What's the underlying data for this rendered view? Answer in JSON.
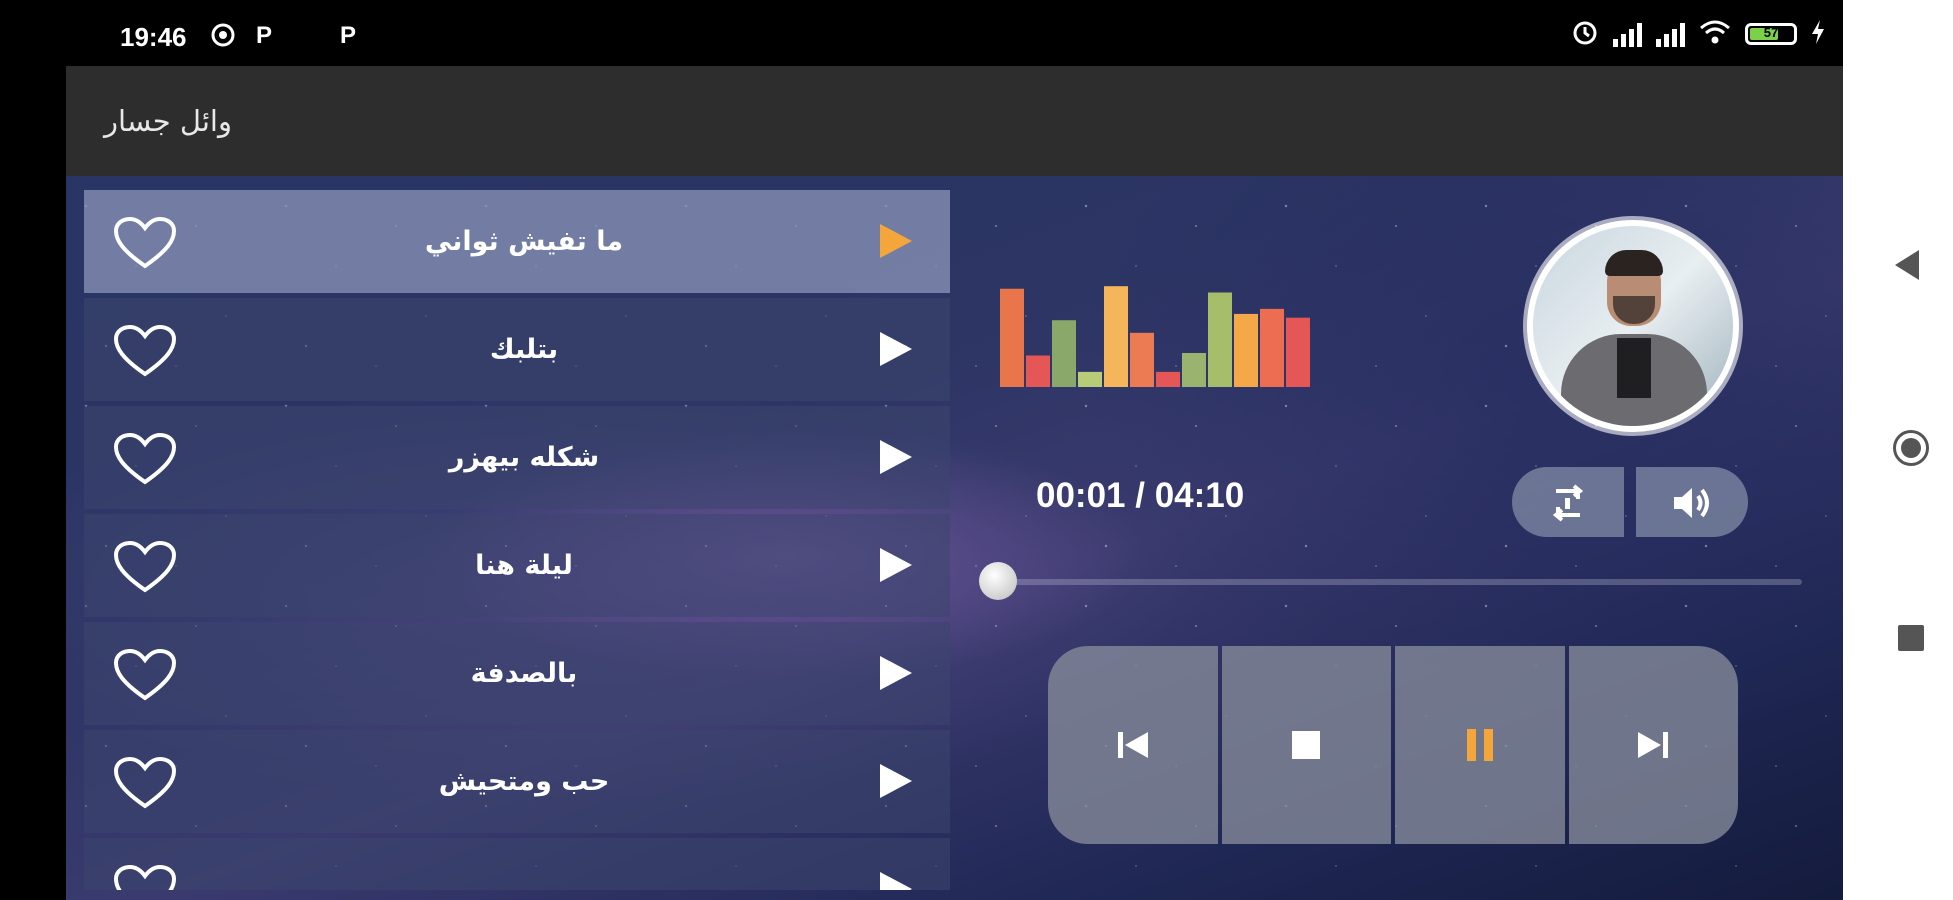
{
  "status_bar": {
    "time": "19:46",
    "notification_icons": [
      "sync-icon",
      "p-icon",
      "p-icon"
    ],
    "p_letter": "P",
    "battery_level": "57",
    "right_icons": [
      "alarm-icon",
      "signal-icon",
      "signal-icon",
      "wifi-icon",
      "battery-icon",
      "charging-icon"
    ]
  },
  "app_bar": {
    "title": "وائل جسار"
  },
  "playlist": {
    "tracks": [
      {
        "title": "ما تفيش ثواني",
        "active": true
      },
      {
        "title": "بتلبك",
        "active": false
      },
      {
        "title": "شكله بيهزر",
        "active": false
      },
      {
        "title": "ليلة هنا",
        "active": false
      },
      {
        "title": "بالصدفة",
        "active": false
      },
      {
        "title": "حب ومتحيش",
        "active": false
      },
      {
        "title": "",
        "active": false
      }
    ],
    "active_color": "#f5a63a"
  },
  "player": {
    "time_display": "00:01 / 04:10",
    "progress": 0.004,
    "equalizer_levels": [
      {
        "level": 0.78,
        "color": "#e8764a"
      },
      {
        "level": 0.25,
        "color": "#e55757"
      },
      {
        "level": 0.53,
        "color": "#8aa86a"
      },
      {
        "level": 0.12,
        "color": "#b8cc78"
      },
      {
        "level": 0.8,
        "color": "#f5b55a"
      },
      {
        "level": 0.43,
        "color": "#ec7a52"
      },
      {
        "level": 0.12,
        "color": "#e55757"
      },
      {
        "level": 0.27,
        "color": "#9ab46f"
      },
      {
        "level": 0.75,
        "color": "#a6bd6a"
      },
      {
        "level": 0.58,
        "color": "#f5a848"
      },
      {
        "level": 0.62,
        "color": "#ec6d52"
      },
      {
        "level": 0.55,
        "color": "#e55757"
      }
    ],
    "controls": [
      "skip-previous-icon",
      "stop-icon",
      "pause-icon",
      "skip-next-icon"
    ],
    "pause_color": "#f5a63a"
  }
}
